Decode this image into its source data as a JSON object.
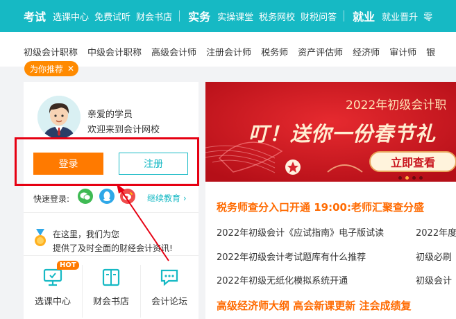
{
  "topbar": {
    "groups": [
      {
        "title": "考试",
        "links": [
          "选课中心",
          "免费试听",
          "财会书店"
        ]
      },
      {
        "title": "实务",
        "links": [
          "实操课堂",
          "税务网校",
          "财税问答"
        ]
      },
      {
        "title": "就业",
        "links": [
          "就业晋升",
          "零"
        ]
      }
    ]
  },
  "categories": [
    "初级会计职称",
    "中级会计职称",
    "高级会计师",
    "注册会计师",
    "税务师",
    "资产评估师",
    "经济师",
    "审计师",
    "银"
  ],
  "recommend_tag": {
    "label": "为你推荐",
    "close": "✕"
  },
  "user_panel": {
    "greeting_line1": "亲爱的学员",
    "greeting_line2": "欢迎来到会计网校",
    "login_label": "登录",
    "register_label": "注册",
    "quick_login_label": "快速登录:",
    "continue_edu": "继续教育 ›",
    "info_line1": "在这里，我们为您",
    "info_line2": "提供了及时全面的财经会计资讯!",
    "hot_badge": "HOT",
    "tools": [
      "选课中心",
      "财会书店",
      "会计论坛"
    ]
  },
  "banner": {
    "line1": "2022年初级会计职",
    "line2": "叮！送你一份春节礼",
    "button": "立即查看",
    "dot_count": 4,
    "active_dot": 1
  },
  "news": {
    "headline1": "税务师查分入口开通  19:00:老师汇聚查分盛",
    "rows": [
      {
        "left": "2022年初级会计《应试指南》电子版试读",
        "right": "2022年度"
      },
      {
        "left": "2022年初级会计考试题库有什么推荐",
        "right": "初级必刷"
      },
      {
        "left": "2022年初级无纸化模拟系统开通",
        "right": "初级会计"
      }
    ],
    "headline2": "高级经济师大纲  高会新课更新  注会成绩复"
  },
  "colors": {
    "teal": "#16b9c4",
    "orange": "#ff7a00",
    "red_banner": "#c9141e",
    "annotation_red": "#e60012"
  }
}
